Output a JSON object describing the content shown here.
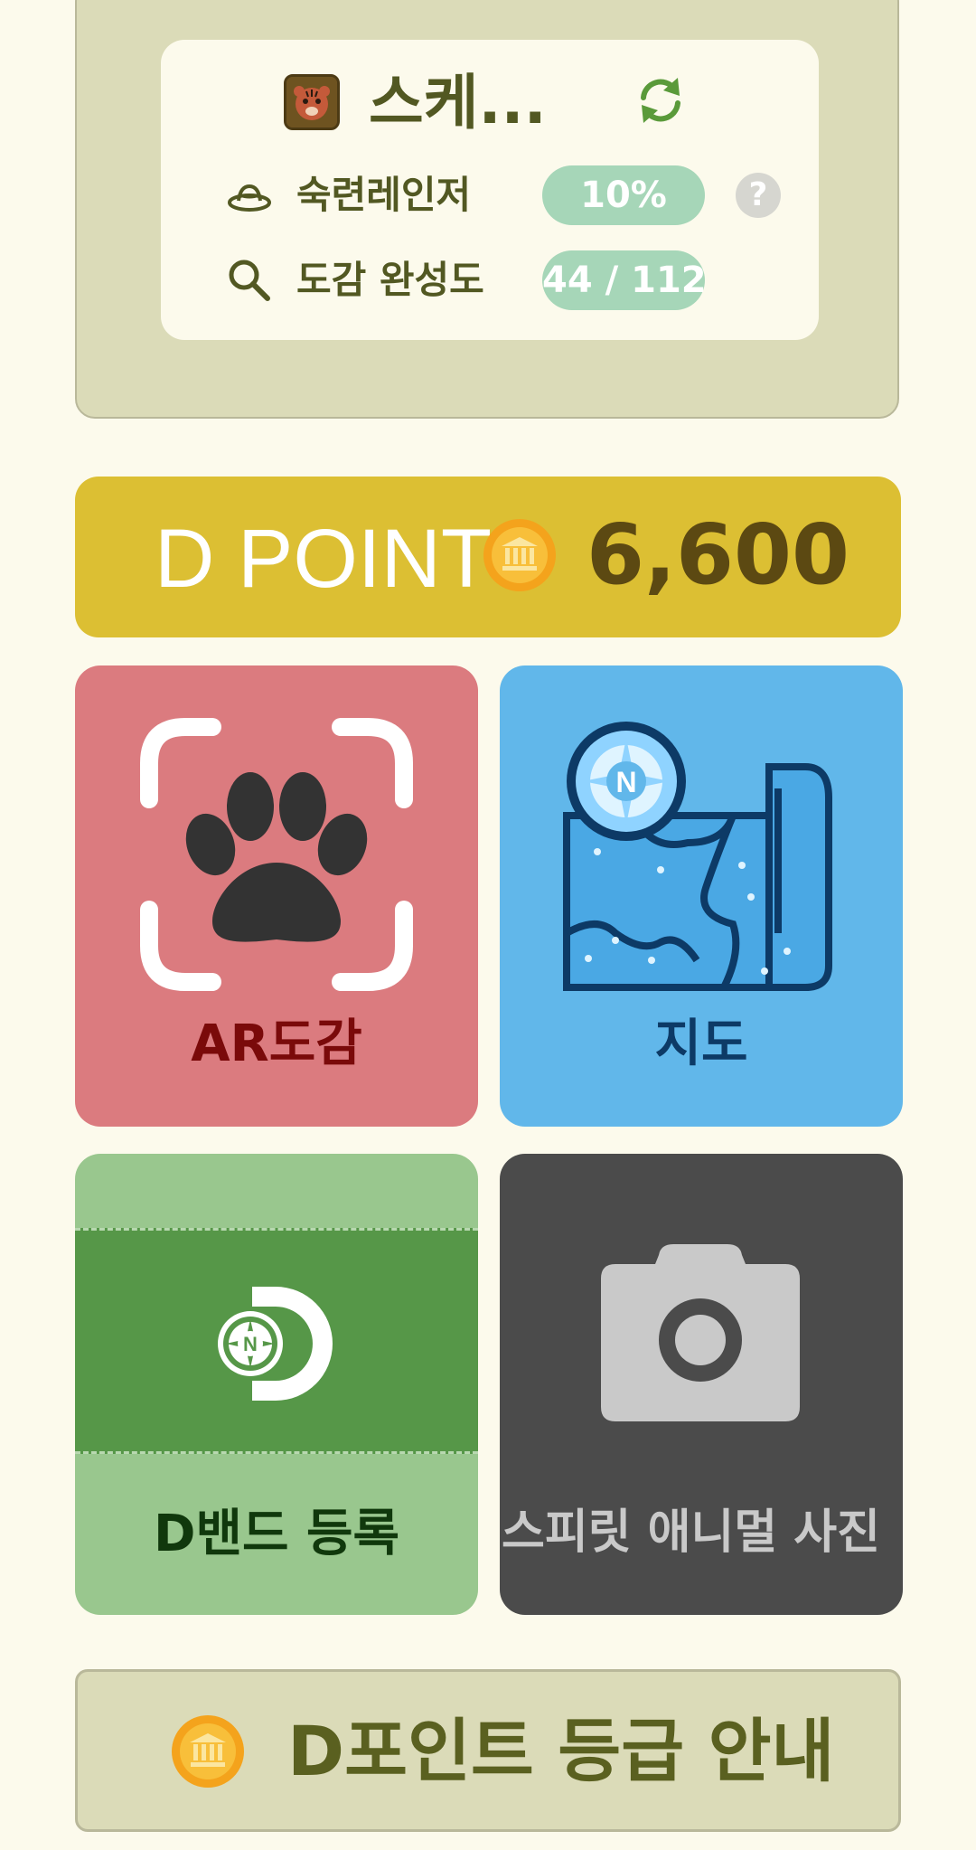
{
  "profile": {
    "nickname": "스케...",
    "stats": [
      {
        "label": "숙련레인저",
        "value": "10%"
      },
      {
        "label": "도감 완성도",
        "value": "44 / 112"
      }
    ],
    "help_label": "?"
  },
  "dpoint": {
    "label": "D POINT",
    "value": "6,600"
  },
  "tiles": [
    {
      "label": "AR도감",
      "icon": "paw-scan-icon",
      "color": "#db7b7f",
      "text_color": "#7a0a0a"
    },
    {
      "label": "지도",
      "icon": "map-icon",
      "color": "#61b7ea",
      "text_color": "#0d3a66"
    },
    {
      "label": "D밴드 등록",
      "icon": "d-band-logo-icon",
      "color": "#99c78e",
      "text_color": "#10380c"
    },
    {
      "label": "스피릿 애니멀 사진",
      "icon": "camera-icon",
      "color": "#4b4b4b",
      "text_color": "#c9c9c9"
    }
  ],
  "guide": {
    "label": "D포인트 등급 안내"
  },
  "colors": {
    "background": "#fcfaec",
    "panel": "#dbdbb8",
    "accent_green": "#525822",
    "pill": "#a6d6b8",
    "dpoint_bar": "#dcbf33"
  }
}
